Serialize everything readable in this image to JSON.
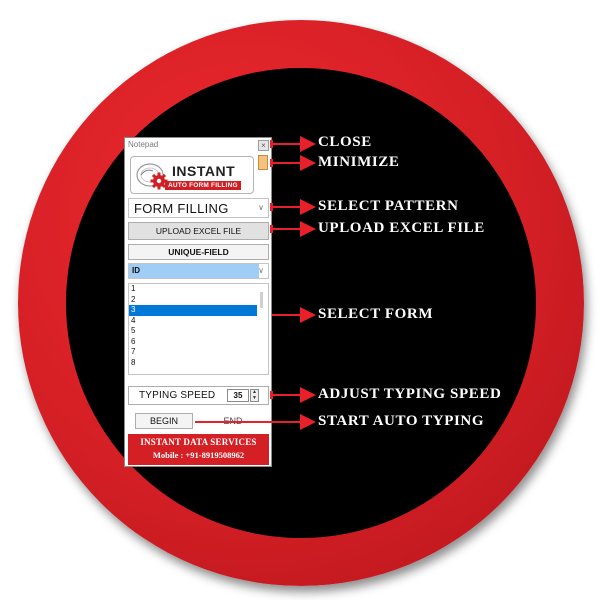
{
  "window": {
    "title": "Notepad",
    "close_glyph": "×"
  },
  "logo": {
    "word": "INSTANT",
    "tagline": "AUTO FORM FILLING",
    "icon": "gear-logo-icon"
  },
  "pattern_select": {
    "value": "FORM FILLING"
  },
  "buttons": {
    "upload": "UPLOAD EXCEL FILE",
    "unique": "UNIQUE-FIELD",
    "begin": "BEGIN",
    "end": "END"
  },
  "field_select": {
    "value": "ID"
  },
  "form_list": {
    "items": [
      "1",
      "2",
      "3",
      "4",
      "5",
      "6",
      "7",
      "8"
    ],
    "selected": "3"
  },
  "typing_speed": {
    "label": "TYPING SPEED",
    "value": "35"
  },
  "footer": {
    "company": "INSTANT DATA SERVICES",
    "mobile": "Mobile : +91-8919508962"
  },
  "callouts": {
    "close": "CLOSE",
    "minimize": "MINIMIZE",
    "select_pattern": "SELECT PATTERN",
    "upload_excel": "UPLOAD EXCEL FILE",
    "select_form": "SELECT FORM",
    "adjust_speed": "ADJUST TYPING SPEED",
    "start_typing": "START AUTO TYPING"
  },
  "colors": {
    "ring": "#d41f25",
    "disc": "#000000",
    "arrow": "#e8202a",
    "selection": "#0078d7",
    "field_highlight": "#9fcdf6"
  }
}
